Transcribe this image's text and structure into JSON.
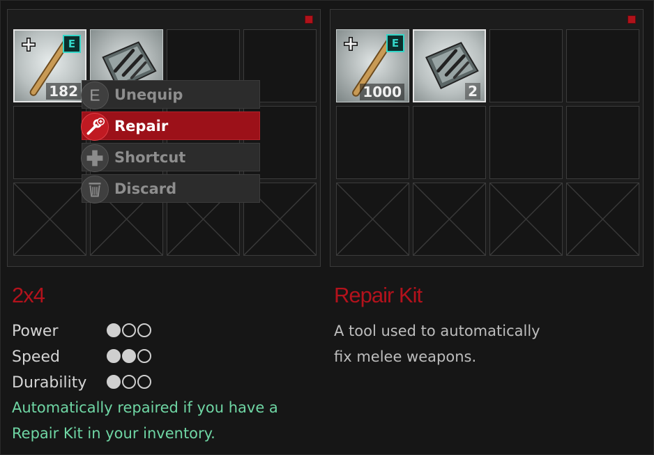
{
  "left_inventory": {
    "items": [
      {
        "name": "2x4",
        "count": "182",
        "equipped_badge": "E",
        "icon": "wooden-plank-icon"
      },
      {
        "name": "Repair Kit",
        "icon": "repair-kit-icon"
      }
    ]
  },
  "right_inventory": {
    "items": [
      {
        "name": "2x4",
        "count": "1000",
        "equipped_badge": "E",
        "icon": "wooden-plank-icon"
      },
      {
        "name": "Repair Kit",
        "count": "2",
        "icon": "repair-kit-icon"
      }
    ]
  },
  "context_menu": {
    "items": [
      {
        "label": "Unequip",
        "icon": "equip-e-icon",
        "glyph": "E"
      },
      {
        "label": "Repair",
        "icon": "wrench-icon",
        "selected": true
      },
      {
        "label": "Shortcut",
        "icon": "dpad-icon"
      },
      {
        "label": "Discard",
        "icon": "trash-icon"
      }
    ]
  },
  "left_detail": {
    "title": "2x4",
    "stats": [
      {
        "label": "Power",
        "level": 1,
        "max": 3
      },
      {
        "label": "Speed",
        "level": 2,
        "max": 3
      },
      {
        "label": "Durability",
        "level": 1,
        "max": 3
      }
    ],
    "note_line1": "Automatically repaired if you have a",
    "note_line2": "Repair Kit in your inventory."
  },
  "right_detail": {
    "title": "Repair Kit",
    "desc_line1": "A tool used to automatically",
    "desc_line2": "fix melee weapons."
  },
  "colors": {
    "accent_red": "#b3121c",
    "equip_teal": "#33d6c8",
    "note_green": "#6fd6a4"
  }
}
